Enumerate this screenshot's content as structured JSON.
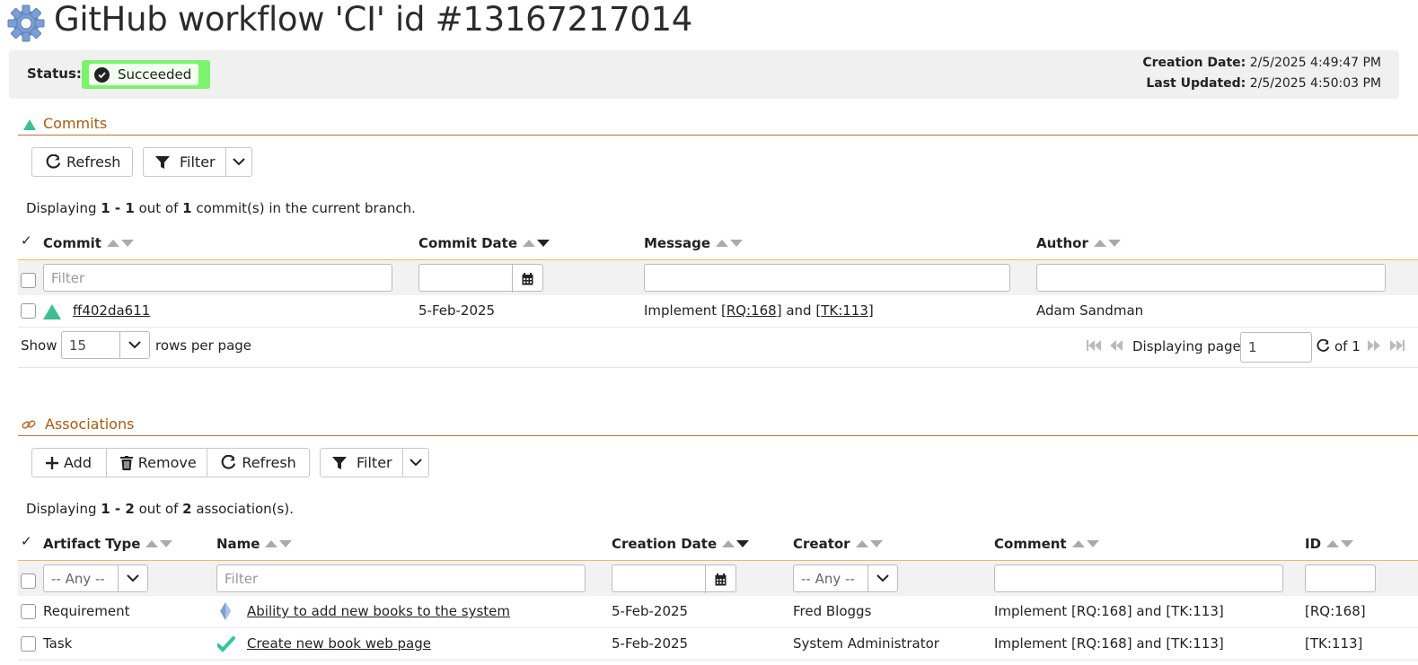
{
  "header": {
    "title": "GitHub workflow 'CI' id #13167217014"
  },
  "status": {
    "label": "Status:",
    "value": "Succeeded",
    "color": "#7cf36d",
    "creation_label": "Creation Date:",
    "creation_value": "2/5/2025 4:49:47 PM",
    "updated_label": "Last Updated:",
    "updated_value": "2/5/2025 4:50:03 PM"
  },
  "commits": {
    "title": "Commits",
    "refresh_label": "Refresh",
    "filter_label": "Filter",
    "info": {
      "pre": "Displaying ",
      "from": "1",
      "sep": " - ",
      "to": "1",
      "mid": " out of ",
      "total": "1",
      "post": " commit(s) in the current branch."
    },
    "columns": [
      "Commit",
      "Commit Date",
      "Message",
      "Author"
    ],
    "filter_placeholder": "Filter",
    "rows": [
      {
        "commit": "ff402da611",
        "date": "5-Feb-2025",
        "msg_pre": "Implement [",
        "msg_link1": "RQ:168",
        "msg_mid": "] and [",
        "msg_link2": "TK:113",
        "msg_post": "]",
        "author": "Adam Sandman"
      }
    ],
    "pager": {
      "show_label": "Show",
      "rows_value": "15",
      "rows_suffix": "rows per page",
      "displaying_label": "Displaying page",
      "page_value": "1",
      "of_label": "of 1"
    }
  },
  "associations": {
    "title": "Associations",
    "add_label": "Add",
    "remove_label": "Remove",
    "refresh_label": "Refresh",
    "filter_label": "Filter",
    "info": {
      "pre": "Displaying ",
      "from": "1",
      "sep": " - ",
      "to": "2",
      "mid": " out of ",
      "total": "2",
      "post": " association(s)."
    },
    "columns": [
      "Artifact Type",
      "Name",
      "Creation Date",
      "Creator",
      "Comment",
      "ID"
    ],
    "any_label": "-- Any --",
    "filter_placeholder": "Filter",
    "rows": [
      {
        "type": "Requirement",
        "icon": "requirement-icon",
        "name": "Ability to add new books to the system",
        "date": "5-Feb-2025",
        "creator": "Fred Bloggs",
        "comment": "Implement [RQ:168] and [TK:113]",
        "id": "[RQ:168]"
      },
      {
        "type": "Task",
        "icon": "task-icon",
        "name": "Create new book web page",
        "date": "5-Feb-2025",
        "creator": "System Administrator",
        "comment": "Implement [RQ:168] and [TK:113]",
        "id": "[TK:113]"
      }
    ]
  }
}
